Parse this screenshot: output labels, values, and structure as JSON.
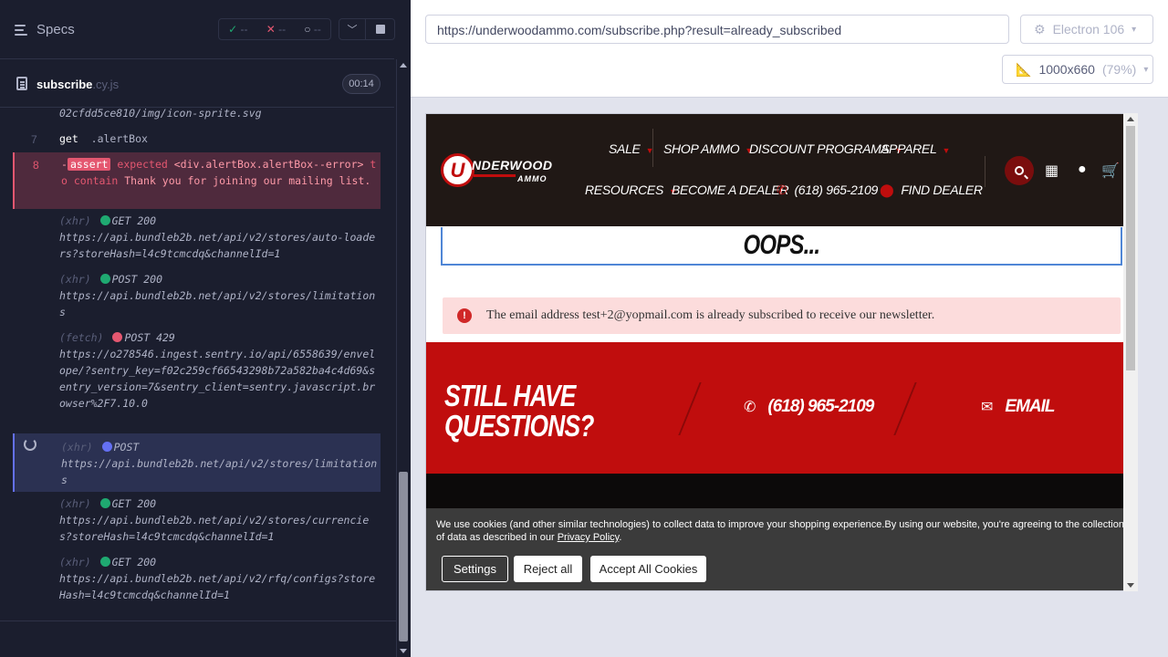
{
  "reporter": {
    "title": "Specs",
    "stats": {
      "passed": "--",
      "failed": "--",
      "pending": "--"
    },
    "file": {
      "name": "subscribe",
      "ext": ".cy.js",
      "duration": "00:14"
    },
    "commands": {
      "url_tail": "02cfdd5ce810/img/icon-sprite.svg",
      "get": {
        "num": "7",
        "keyword": "get",
        "selector": ".alertBox"
      },
      "assert": {
        "num": "8",
        "prefix": "-",
        "keyword": "assert",
        "text1": "expected",
        "subject": "<div.alertBox.alertBox--error>",
        "text2": "to contain",
        "value": "Thank you for joining our mailing list."
      },
      "xhr1": {
        "type": "(xhr)",
        "method": "GET 200",
        "url": "https://api.bundleb2b.net/api/v2/stores/auto-loaders?storeHash=l4c9tcmcdq&channelId=1"
      },
      "xhr2": {
        "type": "(xhr)",
        "method": "POST 200",
        "url": "https://api.bundleb2b.net/api/v2/stores/limitations"
      },
      "fetch": {
        "type": "(fetch)",
        "method": "POST 429",
        "url": "https://o278546.ingest.sentry.io/api/6558639/envelope/?sentry_key=f02c259cf66543298b72a582ba4c4d69&sentry_version=7&sentry_client=sentry.javascript.browser%2F7.10.0"
      },
      "xhr3": {
        "type": "(xhr)",
        "method": "POST",
        "url": "https://api.bundleb2b.net/api/v2/stores/limitations"
      },
      "xhr4": {
        "type": "(xhr)",
        "method": "GET 200",
        "url": "https://api.bundleb2b.net/api/v2/stores/currencies?storeHash=l4c9tcmcdq&channelId=1"
      },
      "xhr5": {
        "type": "(xhr)",
        "method": "GET 200",
        "url": "https://api.bundleb2b.net/api/v2/rfq/configs?storeHash=l4c9tcmcdq&channelId=1"
      }
    }
  },
  "aut": {
    "url": "https://underwoodammo.com/subscribe.php?result=already_subscribed",
    "browser": "Electron 106",
    "viewport": "1000x660",
    "scale": "(79%)"
  },
  "site": {
    "logo": {
      "letter": "U",
      "word": "NDERWOOD",
      "sub": "AMMO"
    },
    "nav": {
      "sale": "SALE",
      "shop_ammo": "SHOP AMMO",
      "discount_programs": "DISCOUNT PROGRAMS",
      "apparel": "APPAREL",
      "resources": "RESOURCES",
      "become_dealer": "BECOME A DEALER",
      "phone": "(618) 965-2109",
      "find_dealer": "FIND DEALER"
    },
    "oops": "OOPS...",
    "alert": "The email address test+2@yopmail.com is already subscribed to receive our newsletter.",
    "questions": {
      "title": "STILL HAVE QUESTIONS?",
      "phone": "(618) 965-2109",
      "email": "EMAIL"
    },
    "cookie": {
      "text": "We use cookies (and other similar technologies) to collect data to improve your shopping experience.By using our website, you're agreeing to the collection of data as described in our ",
      "policy_link": "Privacy Policy",
      "period": ".",
      "settings": "Settings",
      "reject": "Reject all",
      "accept": "Accept All Cookies"
    }
  },
  "colors": {
    "brand_red": "#c00d0d",
    "header_dark": "#201815",
    "cypress_fail": "#e45770",
    "cypress_pass": "#1fa971"
  }
}
